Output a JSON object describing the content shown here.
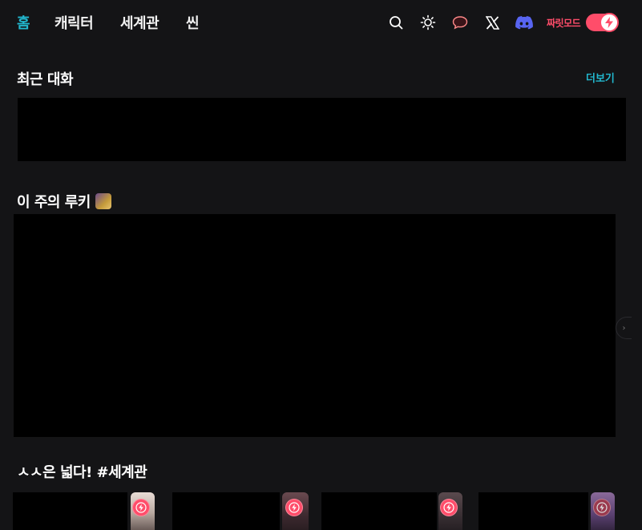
{
  "nav": {
    "tabs": [
      {
        "label": "홈",
        "active": true
      },
      {
        "label": "캐릭터",
        "active": false
      },
      {
        "label": "세계관",
        "active": false
      },
      {
        "label": "씬",
        "active": false
      }
    ],
    "icons": [
      "search-icon",
      "sun-icon",
      "chat-bubble-icon",
      "x-logo-icon",
      "discord-icon"
    ],
    "spark_mode_label": "짜릿모드",
    "spark_mode_on": true
  },
  "recent": {
    "title": "최근 대화",
    "more_label": "더보기"
  },
  "rookie": {
    "title": "이 주의 루키"
  },
  "world": {
    "title": "ㅅㅅ은 넓다! #세계관"
  },
  "colors": {
    "accent": "#22b8cf",
    "spark": "#ff4d6a",
    "background": "#141416"
  }
}
